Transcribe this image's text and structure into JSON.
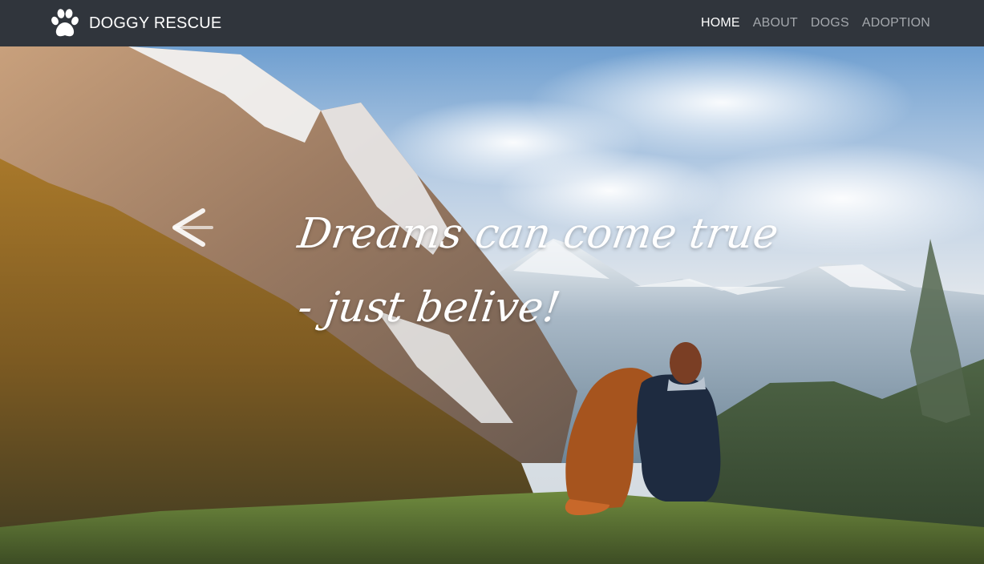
{
  "navbar": {
    "brand": {
      "icon": "paw-icon",
      "text": "DOGGY RESCUE"
    },
    "links": [
      {
        "label": "HOME",
        "active": true
      },
      {
        "label": "ABOUT",
        "active": false
      },
      {
        "label": "DOGS",
        "active": false
      },
      {
        "label": "ADOPTION",
        "active": false
      }
    ]
  },
  "hero": {
    "control_icon": "chevron-left-icon",
    "caption_line_1": "Dreams can come true",
    "caption_line_2": "- just belive!"
  },
  "colors": {
    "navbar_bg": "#30353c",
    "nav_link": "#a4a8ad",
    "nav_link_active": "#ffffff"
  }
}
